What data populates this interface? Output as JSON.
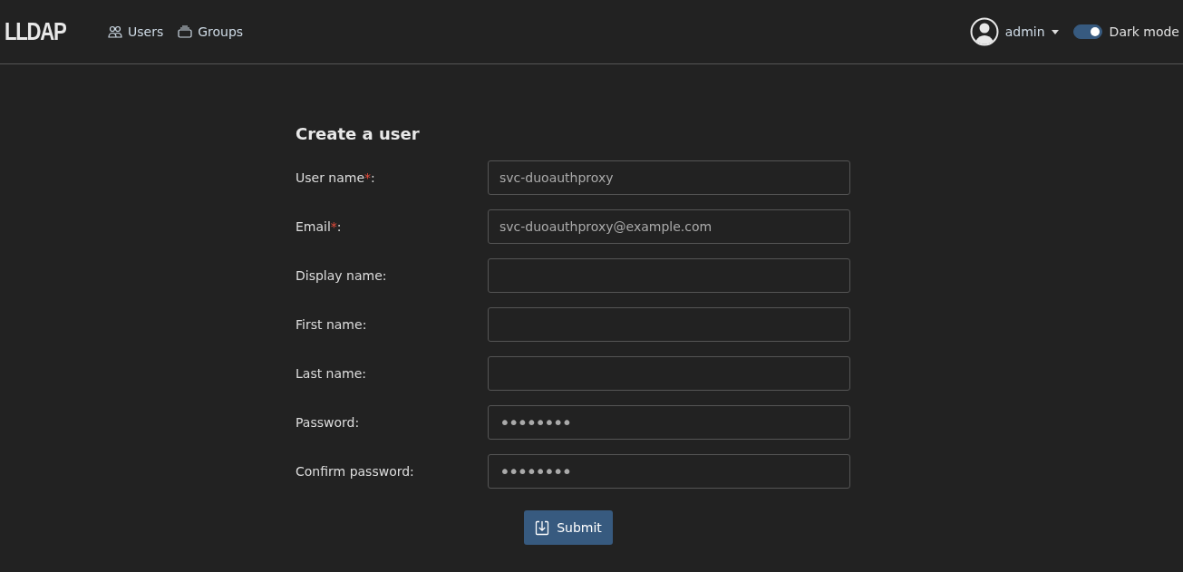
{
  "navbar": {
    "logo": "LLDAP",
    "links": [
      {
        "label": "Users"
      },
      {
        "label": "Groups"
      }
    ],
    "user_menu": {
      "label": "admin"
    },
    "dark_mode": {
      "label": "Dark mode",
      "on": true
    }
  },
  "form": {
    "title": "Create a user",
    "fields": [
      {
        "label": "User name",
        "required_mark": "*",
        "label_end": ":",
        "value": "svc-duoauthproxy"
      },
      {
        "label": "Email",
        "required_mark": "*",
        "label_end": ":",
        "value": "svc-duoauthproxy@example.com"
      },
      {
        "label": "Display name",
        "label_end": ":"
      },
      {
        "label": "First name",
        "label_end": ":"
      },
      {
        "label": "Last name",
        "label_end": ":"
      },
      {
        "label": "Password",
        "label_end": ":",
        "value": "••••••••",
        "kind": "password"
      },
      {
        "label": "Confirm password",
        "label_end": ":",
        "value": "••••••••",
        "kind": "password"
      }
    ],
    "submit": {
      "label": "Submit"
    }
  }
}
